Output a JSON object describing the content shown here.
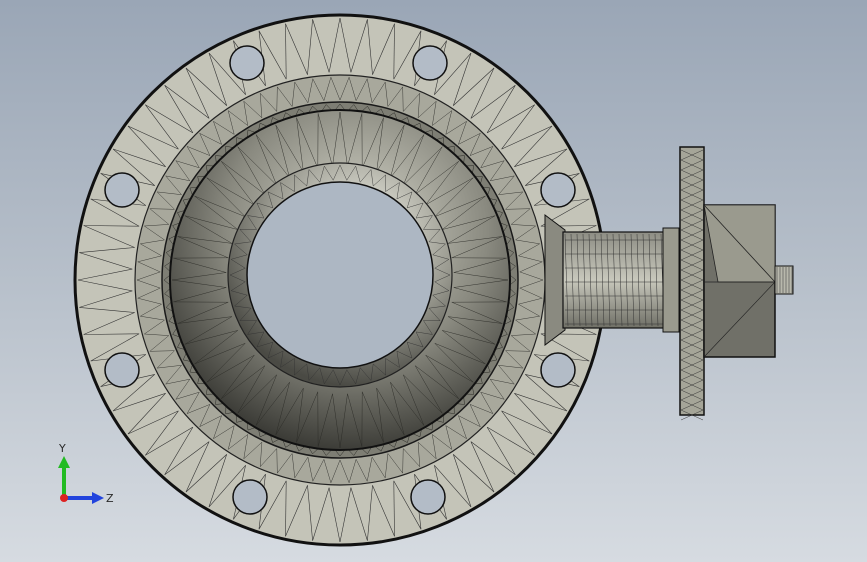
{
  "viewport": {
    "background_top": "#9aa6b6",
    "background_bottom": "#d6dbe1"
  },
  "model": {
    "type": "butterfly-valve-wireframe",
    "body_fill": "#c4c4b8",
    "dark_fill": "#3a3a36",
    "edge_color": "#1a1a1a"
  },
  "triad": {
    "y_label": "Y",
    "z_label": "Z",
    "y_color": "#22bb22",
    "z_color": "#2244dd",
    "x_color": "#dd2222"
  }
}
